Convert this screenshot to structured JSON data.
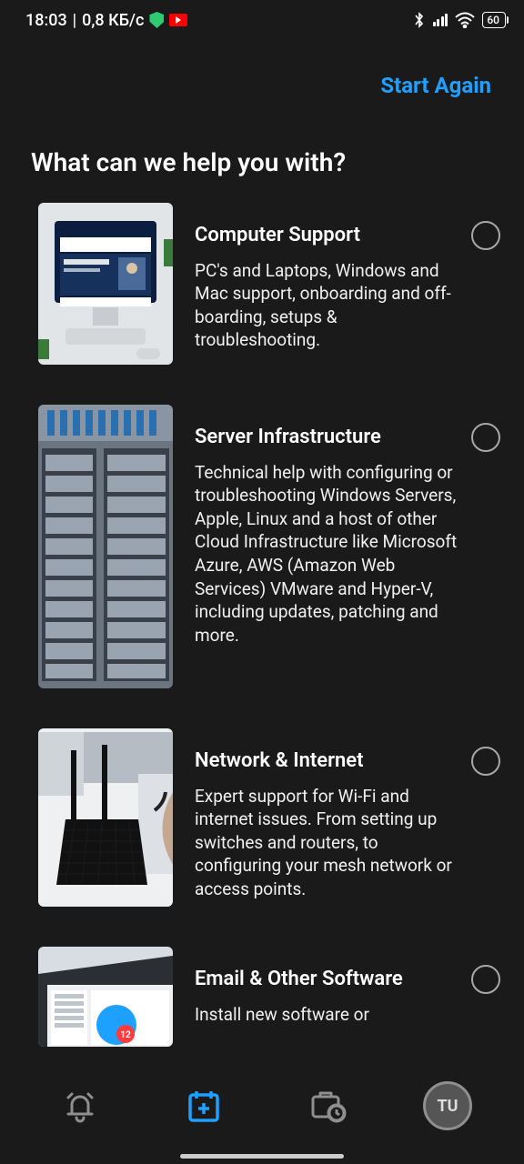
{
  "status": {
    "time": "18:03",
    "net_speed": "0,8 КБ/с",
    "battery_percent": "60"
  },
  "header": {
    "start_again": "Start Again"
  },
  "title": "What can we help you with?",
  "options": [
    {
      "title": "Computer Support",
      "desc": "PC's and Laptops, Windows and Mac support, onboarding and off-boarding, setups & troubleshooting."
    },
    {
      "title": "Server Infrastructure",
      "desc": "Technical help with configuring or troubleshooting Windows Servers, Apple, Linux and a host of other Cloud Infrastructure like Microsoft Azure, AWS (Amazon Web Services) VMware and Hyper-V, including updates, patching and more."
    },
    {
      "title": "Network & Internet",
      "desc": "Expert support for Wi-Fi and internet issues. From setting up switches and routers, to configuring your mesh network or access points."
    },
    {
      "title": "Email & Other Software",
      "desc": "Install new software or"
    }
  ],
  "nav": {
    "avatar_initials": "TU"
  }
}
